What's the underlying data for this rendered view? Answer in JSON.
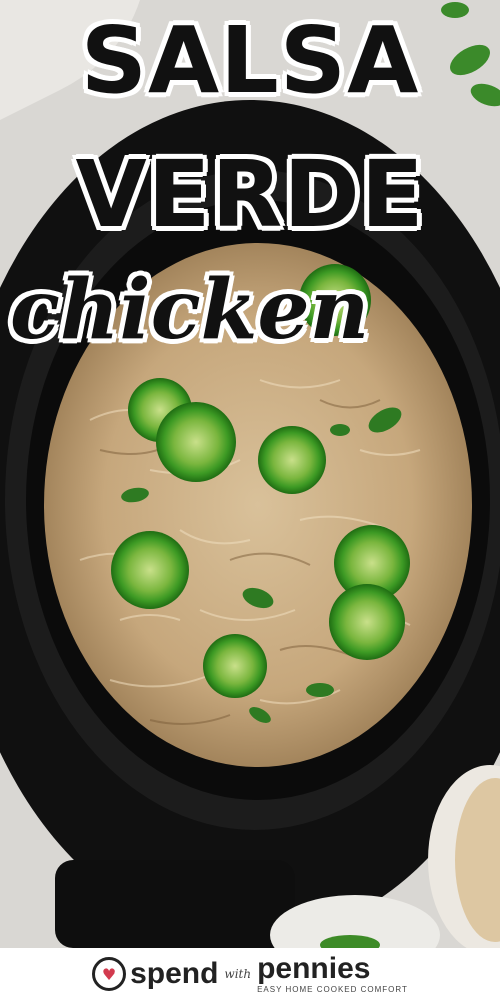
{
  "title": {
    "line1": "SALSA",
    "line2": "VERDE",
    "line3": "chicken"
  },
  "brand": {
    "word1": "spend",
    "connector": "with",
    "word2": "pennies",
    "tagline": "EASY HOME COOKED COMFORT",
    "accent_color": "#d23a4e"
  },
  "photo": {
    "subject": "shredded chicken with salsa verde, jalapeño slices and cilantro in a black slow cooker",
    "colors": {
      "pot": "#141414",
      "chicken": "#c9ad86",
      "jalapeno": "#2f8f1f",
      "counter": "#d6d4d0"
    }
  }
}
